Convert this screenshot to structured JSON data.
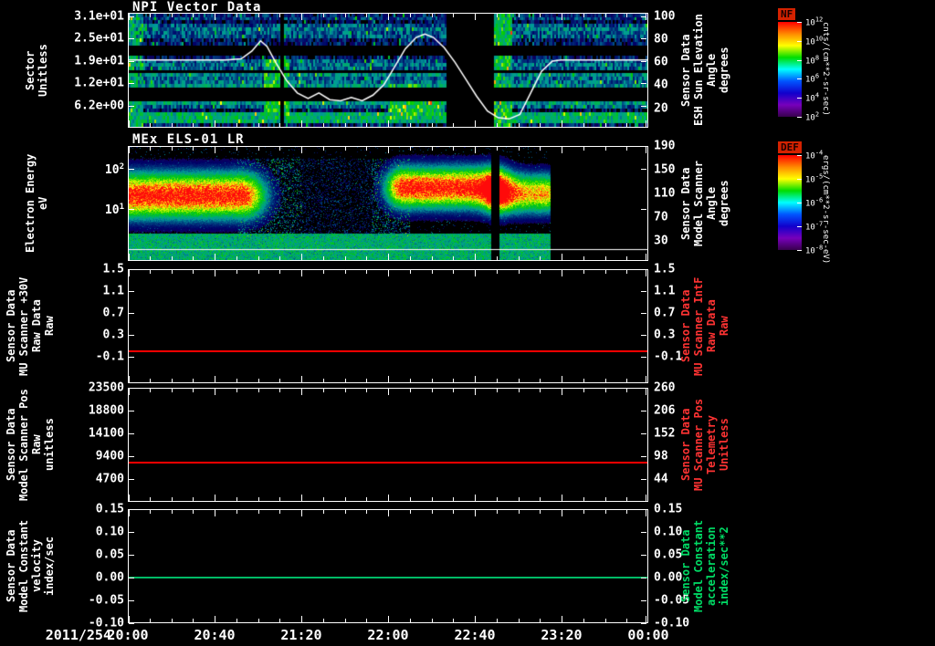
{
  "x_axis": {
    "date_label": "2011/254",
    "range_minutes": [
      0,
      240
    ],
    "ticks": [
      {
        "label": "20:00",
        "min": 0,
        "pos": 0
      },
      {
        "label": "20:40",
        "min": 40,
        "pos": 0.1667
      },
      {
        "label": "21:20",
        "min": 80,
        "pos": 0.3333
      },
      {
        "label": "22:00",
        "min": 120,
        "pos": 0.5
      },
      {
        "label": "22:40",
        "min": 160,
        "pos": 0.6667
      },
      {
        "label": "23:20",
        "min": 200,
        "pos": 0.8333
      },
      {
        "label": "00:00",
        "min": 240,
        "pos": 1
      }
    ]
  },
  "chart_data": [
    {
      "id": "npi",
      "type": "heatmap",
      "title": "NPI Vector Data",
      "ylabel_lines": [
        "Sector",
        "Unitless"
      ],
      "y_axis": {
        "range": [
          0,
          32
        ],
        "ticks": [
          {
            "label": "3.1e+01",
            "pos": 0.031
          },
          {
            "label": "2.5e+01",
            "pos": 0.225
          },
          {
            "label": "1.9e+01",
            "pos": 0.419
          },
          {
            "label": "1.2e+01",
            "pos": 0.613
          },
          {
            "label": "6.2e+00",
            "pos": 0.806
          }
        ]
      },
      "right_axis": {
        "color": "#ffffff",
        "range": [
          3,
          103
        ],
        "label_lines": [
          "Sensor Data",
          "ESH Sun Elevation",
          "Angle",
          "degrees"
        ],
        "ticks": [
          {
            "label": "100",
            "pos": 0.03
          },
          {
            "label": "80",
            "pos": 0.23
          },
          {
            "label": "60",
            "pos": 0.43
          },
          {
            "label": "40",
            "pos": 0.63
          },
          {
            "label": "20",
            "pos": 0.83
          }
        ]
      },
      "colorbar": {
        "name": "NF",
        "unit": "cnts/(cm**2-sr-sec)",
        "ticks": [
          "10^12",
          "10^10",
          "10^8",
          "10^6",
          "10^4",
          "10^2"
        ],
        "colors": [
          "#ff0000",
          "#ff8800",
          "#ffff00",
          "#00dd00",
          "#00ffff",
          "#0055ff",
          "#1100cc",
          "#7700bb",
          "#38004d"
        ]
      },
      "overlay_line": {
        "color": "#ffffff",
        "points_min_deg": [
          [
            0,
            62
          ],
          [
            45,
            62
          ],
          [
            52,
            63
          ],
          [
            57,
            70
          ],
          [
            61,
            79
          ],
          [
            64,
            74
          ],
          [
            68,
            60
          ],
          [
            73,
            44
          ],
          [
            78,
            33
          ],
          [
            83,
            28
          ],
          [
            88,
            33
          ],
          [
            93,
            27
          ],
          [
            98,
            26
          ],
          [
            103,
            29
          ],
          [
            108,
            26
          ],
          [
            113,
            31
          ],
          [
            118,
            40
          ],
          [
            123,
            56
          ],
          [
            128,
            72
          ],
          [
            133,
            82
          ],
          [
            137,
            85
          ],
          [
            141,
            82
          ],
          [
            146,
            73
          ],
          [
            151,
            60
          ],
          [
            156,
            45
          ],
          [
            161,
            30
          ],
          [
            166,
            17
          ],
          [
            171,
            11
          ],
          [
            176,
            10
          ],
          [
            181,
            14
          ],
          [
            186,
            33
          ],
          [
            191,
            52
          ],
          [
            196,
            61
          ],
          [
            200,
            62
          ],
          [
            240,
            62
          ]
        ]
      },
      "spectrogram": {
        "sectors": 32,
        "base_level": 0.22,
        "noise": 0.26,
        "black_row_bands": [
          [
            7,
            10
          ],
          [
            20,
            22
          ],
          [
            15,
            15
          ]
        ],
        "bright_bottom_rows": {
          "rows": [
            1,
            3
          ],
          "level": 0.42
        },
        "data_gaps_min": [
          [
            146.5,
            169
          ],
          [
            69.5,
            71.5
          ]
        ],
        "features": [
          {
            "t": [
              0,
              6
            ],
            "rows": [
              0,
              31
            ],
            "level": 0.4
          },
          {
            "t": [
              62,
              74
            ],
            "rows": [
              2,
              18
            ],
            "level": 0.5
          },
          {
            "t": [
              120,
              136
            ],
            "rows": [
              2,
              11
            ],
            "level": 0.5
          },
          {
            "t": [
              136,
              146
            ],
            "rows": [
              2,
              8
            ],
            "level": 0.45
          },
          {
            "t": [
              169,
              177
            ],
            "rows": [
              0,
              31
            ],
            "level": 0.48
          }
        ]
      }
    },
    {
      "id": "els",
      "type": "heatmap",
      "title": "MEx ELS-01 LR",
      "ylabel_lines": [
        "Electron Energy",
        "eV"
      ],
      "y_axis": {
        "log": true,
        "range_eV": [
          0.5,
          380
        ],
        "ticks": [
          {
            "label": "10^2",
            "pos": 0.201
          },
          {
            "label": "10^1",
            "pos": 0.549
          }
        ]
      },
      "right_axis": {
        "color": "#ffffff",
        "range": [
          -4,
          190
        ],
        "label_lines": [
          "Sensor Data",
          "Model Scanner",
          "Angle",
          "degrees"
        ],
        "ticks": [
          {
            "label": "190",
            "pos": 0
          },
          {
            "label": "150",
            "pos": 0.206
          },
          {
            "label": "110",
            "pos": 0.412
          },
          {
            "label": "70",
            "pos": 0.619
          },
          {
            "label": "30",
            "pos": 0.825
          }
        ]
      },
      "colorbar": {
        "name": "DEF",
        "unit": "ergs/(cm**2-sr-sec-eV)",
        "ticks": [
          "10^-4",
          "10^-5",
          "10^-6",
          "10^-7",
          "10^-8"
        ],
        "colors": [
          "#ff0000",
          "#ff8800",
          "#ffff00",
          "#00dd00",
          "#00ffff",
          "#0055ff",
          "#1100cc",
          "#7700bb",
          "#38004d"
        ]
      },
      "hline": {
        "pos": 0.9,
        "color": "#ffffff"
      },
      "spectrogram": {
        "logE_range": [
          -0.3,
          2.58
        ],
        "data_end_min": 195,
        "low_band": {
          "logE_max": 0.38,
          "level": 0.42
        },
        "mid_speckle": {
          "t": [
            50,
            130
          ],
          "amp": 0.5,
          "dim_t": [
            80,
            112
          ],
          "dim_factor": 0.5
        },
        "gaps_min": [
          [
            167.5,
            171.5
          ]
        ],
        "blobs": [
          {
            "t": [
              0,
              52
            ],
            "fade": 8,
            "center": 1.35,
            "sigma": 0.4,
            "amp": 1.05
          },
          {
            "t": [
              127,
              167
            ],
            "fade": 6,
            "center": 1.55,
            "sigma": 0.36,
            "amp": 1.05
          },
          {
            "t": [
              172,
              193
            ],
            "fade": 5,
            "center": 1.4,
            "sigma": 0.34,
            "amp": 0.85
          }
        ]
      }
    },
    {
      "id": "mu-scanner-30v",
      "type": "line",
      "ylabel_lines": [
        "Sensor Data",
        "MU Scanner +30V",
        "Raw Data",
        "Raw"
      ],
      "y_axis": {
        "range": [
          -0.58,
          1.5
        ],
        "ticks": [
          {
            "label": "1.5",
            "pos": 0
          },
          {
            "label": "1.1",
            "pos": 0.192
          },
          {
            "label": "0.7",
            "pos": 0.385
          },
          {
            "label": "0.3",
            "pos": 0.577
          },
          {
            "label": "-0.1",
            "pos": 0.769
          }
        ]
      },
      "right_axis": {
        "color": "#ff3333",
        "range": [
          -0.58,
          1.5
        ],
        "label_lines": [
          "Sensor Data",
          "MU Scanner IntF",
          "Raw Data",
          "Raw"
        ],
        "ticks": [
          {
            "label": "1.5",
            "pos": 0
          },
          {
            "label": "1.1",
            "pos": 0.192
          },
          {
            "label": "0.7",
            "pos": 0.385
          },
          {
            "label": "0.3",
            "pos": 0.577
          },
          {
            "label": "-0.1",
            "pos": 0.769
          }
        ]
      },
      "series": [
        {
          "name": "MU Scanner +30V Raw Data",
          "color": "#ff0000",
          "constant_value": 0.0,
          "pos": 0.721
        }
      ]
    },
    {
      "id": "model-scanner-pos",
      "type": "line",
      "ylabel_lines": [
        "Sensor Data",
        "Model Scanner Pos",
        "Raw",
        "unitless"
      ],
      "y_axis": {
        "range": [
          0,
          23500
        ],
        "ticks": [
          {
            "label": "23500",
            "pos": 0
          },
          {
            "label": "18800",
            "pos": 0.2
          },
          {
            "label": "14100",
            "pos": 0.4
          },
          {
            "label": "9400",
            "pos": 0.6
          },
          {
            "label": "4700",
            "pos": 0.8
          }
        ]
      },
      "right_axis": {
        "color": "#ff3333",
        "range": [
          -10,
          260
        ],
        "label_lines": [
          "Sensor Data",
          "MU Scanner Pos",
          "Telemetry",
          "Unitless"
        ],
        "ticks": [
          {
            "label": "260",
            "pos": 0
          },
          {
            "label": "206",
            "pos": 0.2
          },
          {
            "label": "152",
            "pos": 0.4
          },
          {
            "label": "98",
            "pos": 0.6
          },
          {
            "label": "44",
            "pos": 0.8
          }
        ]
      },
      "series": [
        {
          "name": "Model Scanner Pos Raw",
          "color": "#ff0000",
          "constant_value": 8100,
          "pos": 0.655
        }
      ]
    },
    {
      "id": "model-constant",
      "type": "line",
      "ylabel_lines": [
        "Sensor Data",
        "Model Constant",
        "velocity",
        "index/sec"
      ],
      "y_axis": {
        "range": [
          -0.1,
          0.15
        ],
        "ticks": [
          {
            "label": "0.15",
            "pos": 0
          },
          {
            "label": "0.10",
            "pos": 0.2
          },
          {
            "label": "0.05",
            "pos": 0.4
          },
          {
            "label": "0.00",
            "pos": 0.6
          },
          {
            "label": "-0.05",
            "pos": 0.8
          },
          {
            "label": "-0.10",
            "pos": 1
          }
        ]
      },
      "right_axis": {
        "color": "#00dd66",
        "range": [
          -0.1,
          0.15
        ],
        "label_lines": [
          "Sensor Data",
          "Model Constant",
          "acceleration",
          "index/sec**2"
        ],
        "ticks": [
          {
            "label": "0.15",
            "pos": 0
          },
          {
            "label": "0.10",
            "pos": 0.2
          },
          {
            "label": "0.05",
            "pos": 0.4
          },
          {
            "label": "0.00",
            "pos": 0.6
          },
          {
            "label": "-0.05",
            "pos": 0.8
          },
          {
            "label": "-0.10",
            "pos": 1
          }
        ]
      },
      "series": [
        {
          "name": "Model Constant velocity",
          "color": "#00bb66",
          "constant_value": 0.0,
          "pos": 0.6
        }
      ]
    }
  ]
}
